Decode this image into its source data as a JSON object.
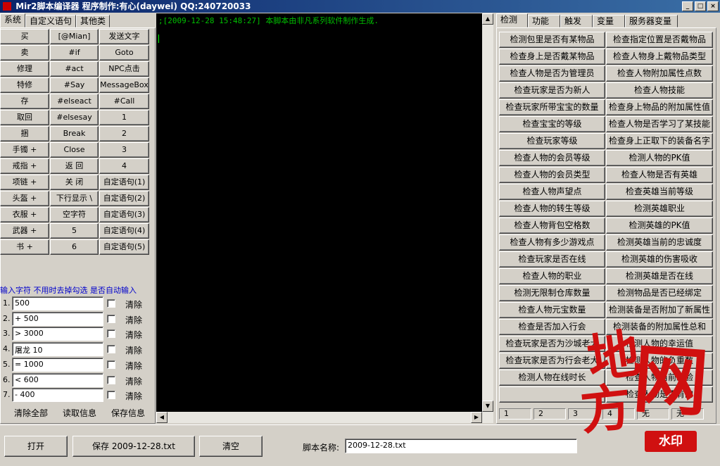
{
  "window": {
    "title": "Mir2脚本编译器 程序制作:有心(daywei) QQ:240720033",
    "min": "_",
    "max": "□",
    "close": "×"
  },
  "left_tabs": [
    "系统",
    "自定义语句",
    "其他类"
  ],
  "left_buttons": [
    [
      "买",
      "[@Mian]",
      "发送文字"
    ],
    [
      "卖",
      "#if",
      "Goto"
    ],
    [
      "修理",
      "#act",
      "NPC点击"
    ],
    [
      "特修",
      "#Say",
      "MessageBox"
    ],
    [
      "存",
      "#elseact",
      "#Call"
    ],
    [
      "取回",
      "#elsesay",
      "1"
    ],
    [
      "捆",
      "Break",
      "2"
    ],
    [
      "手镯 +",
      "Close",
      "3"
    ],
    [
      "戒指 +",
      "返 回",
      "4"
    ],
    [
      "项链 +",
      "关 闭",
      "自定语句(1)"
    ],
    [
      "头盔 +",
      "下行显示 \\",
      "自定语句(2)"
    ],
    [
      "衣服 +",
      "空字符",
      "自定语句(3)"
    ],
    [
      "武器 +",
      "5",
      "自定语句(4)"
    ],
    [
      "书 +",
      "6",
      "自定语句(5)"
    ]
  ],
  "input_hint": "输入字符 不用时去掉勾选 是否自动输入",
  "inputs": [
    {
      "num": "1.",
      "value": "500"
    },
    {
      "num": "2.",
      "value": "+ 500"
    },
    {
      "num": "3.",
      "value": "> 3000"
    },
    {
      "num": "4.",
      "value": "屠龙 10"
    },
    {
      "num": "5.",
      "value": "= 1000"
    },
    {
      "num": "6.",
      "value": "< 600"
    },
    {
      "num": "7.",
      "value": "- 400"
    }
  ],
  "clear_label": "清除",
  "left_links": [
    "清除全部",
    "读取信息",
    "保存信息"
  ],
  "console_text": ";[2009-12-28 15:48:27] 本脚本由非凡系列软件制作生成.",
  "right_tabs": [
    "检测",
    "功能",
    "触发",
    "变量",
    "服务器变量"
  ],
  "right_buttons": [
    [
      "检测包里是否有某物品",
      "检查指定位置是否戴物品"
    ],
    [
      "检查身上是否戴某物品",
      "检查人物身上戴物品类型"
    ],
    [
      "检查人物是否为管理员",
      "检查人物附加属性点数"
    ],
    [
      "检查玩家是否为新人",
      "检查人物技能"
    ],
    [
      "检查玩家所带宝宝的数量",
      "检查身上物品的附加属性值"
    ],
    [
      "检查宝宝的等级",
      "检查人物是否学习了某技能"
    ],
    [
      "检查玩家等级",
      "检查身上正取下的装备名字"
    ],
    [
      "检查人物的会员等级",
      "检测人物的PK值"
    ],
    [
      "检查人物的会员类型",
      "检查人物是否有英雄"
    ],
    [
      "检查人物声望点",
      "检查英雄当前等级"
    ],
    [
      "检查人物的转生等级",
      "检测英雄职业"
    ],
    [
      "检查人物背包空格数",
      "检测英雄的PK值"
    ],
    [
      "检查人物有多少游戏点",
      "检测英雄当前的忠诚度"
    ],
    [
      "检查玩家是否在线",
      "检测英雄的伤害吸收"
    ],
    [
      "检查人物的职业",
      "检测英雄是否在线"
    ],
    [
      "检测无限制仓库数量",
      "检测物品是否已经绑定"
    ],
    [
      "检查人物元宝数量",
      "检测装备是否附加了新属性"
    ],
    [
      "检查是否加入行会",
      "检测装备的附加属性总和"
    ],
    [
      "检查玩家是否为沙城老大",
      "检测人物的幸运值"
    ],
    [
      "检查玩家是否为行会老大",
      "检测人物的负重数"
    ],
    [
      "检测人物在线时长",
      "检查人物当前经验"
    ],
    [
      "",
      "检查人物是否有的"
    ]
  ],
  "pages": [
    "1",
    "2",
    "3",
    "4",
    "无",
    "无"
  ],
  "bottom": {
    "open": "打开",
    "save": "保存 2009-12-28.txt",
    "clear": "清空",
    "script_label": "脚本名称:",
    "script_name": "2009-12-28.txt"
  },
  "watermark": {
    "chars": [
      "地",
      "方",
      "网"
    ],
    "stamp": "水印"
  }
}
